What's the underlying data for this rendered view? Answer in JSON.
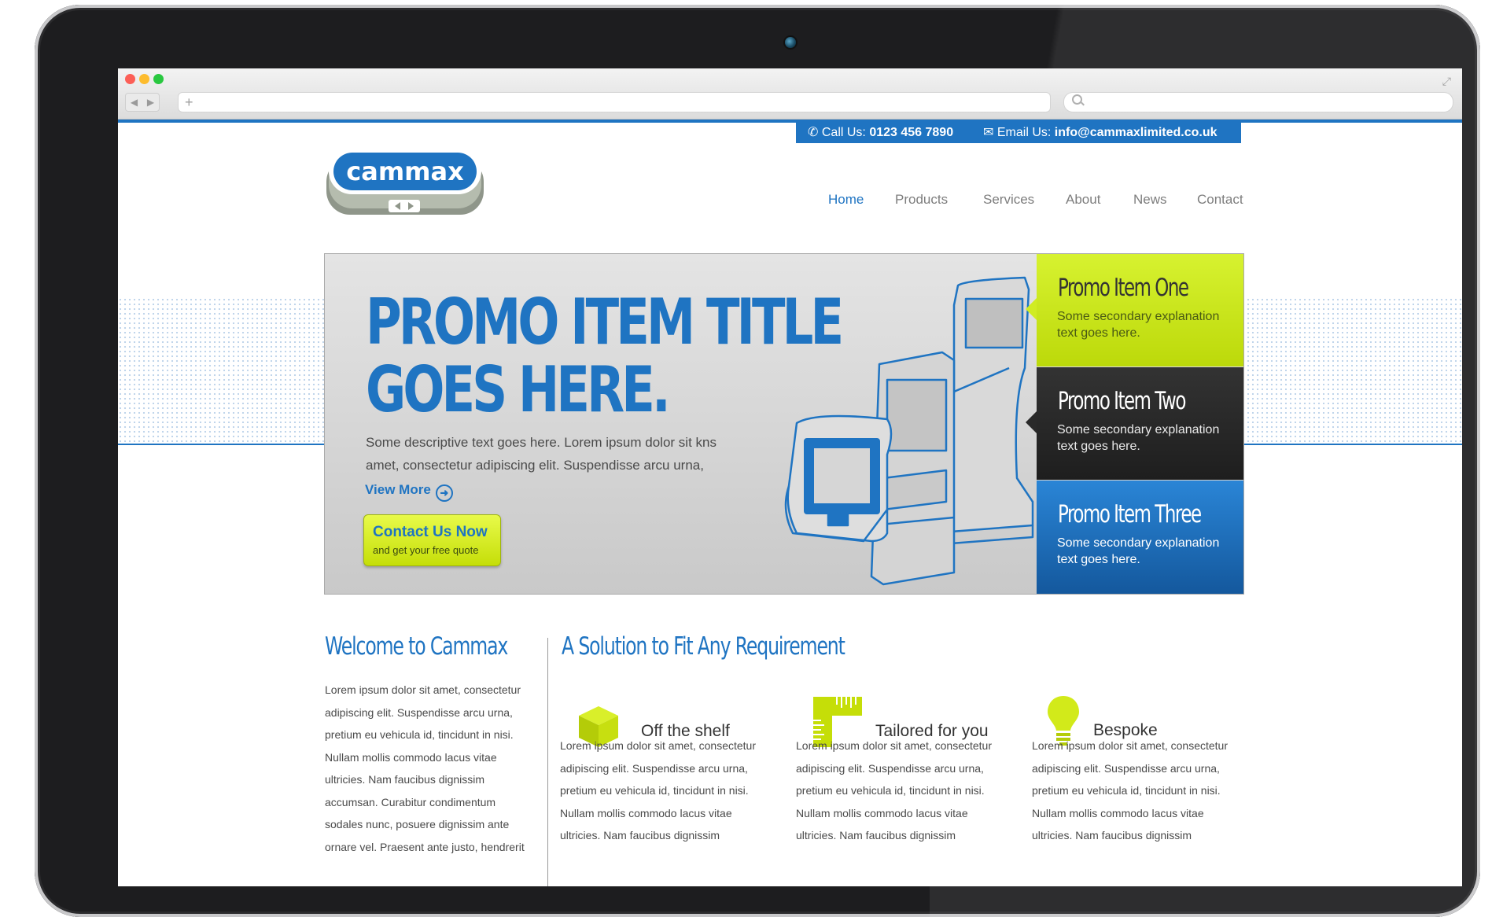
{
  "contact": {
    "call_label": "Call Us:",
    "phone": "0123 456 7890",
    "email_label": "Email Us:",
    "email": "info@cammaxlimited.co.uk"
  },
  "logo": {
    "text": "cammax"
  },
  "nav": {
    "items": [
      {
        "label": "Home",
        "active": true
      },
      {
        "label": "Products",
        "active": false
      },
      {
        "label": "Services",
        "active": false
      },
      {
        "label": "About",
        "active": false
      },
      {
        "label": "News",
        "active": false
      },
      {
        "label": "Contact",
        "active": false
      }
    ]
  },
  "hero": {
    "title_line1": "PROMO ITEM TITLE",
    "title_line2": "GOES HERE.",
    "text_line1": "Some descriptive text goes here. Lorem ipsum dolor sit kns",
    "text_line2": "amet, consectetur adipiscing elit. Suspendisse arcu urna,",
    "view_more": "View More",
    "cta_main": "Contact Us Now",
    "cta_sub": "and get your free quote"
  },
  "promos": [
    {
      "title": "Promo Item One",
      "text_line1": "Some secondary explanation",
      "text_line2": "text goes here."
    },
    {
      "title": "Promo Item Two",
      "text_line1": "Some secondary explanation",
      "text_line2": "text goes here."
    },
    {
      "title": "Promo Item Three",
      "text_line1": "Some secondary explanation",
      "text_line2": "text goes here."
    }
  ],
  "welcome": {
    "heading": "Welcome to Cammax",
    "lines": [
      "Lorem ipsum dolor sit amet, consectetur",
      "adipiscing elit. Suspendisse arcu urna,",
      "pretium eu vehicula id, tincidunt in nisi.",
      "Nullam mollis commodo lacus vitae",
      "ultricies. Nam faucibus dignissim",
      "accumsan. Curabitur condimentum",
      "sodales nunc, posuere dignissim ante",
      "ornare vel. Praesent ante justo, hendrerit"
    ]
  },
  "solution": {
    "heading": "A Solution to Fit Any Requirement",
    "features": [
      {
        "icon": "box-icon",
        "label": "Off the shelf",
        "lines": [
          "Lorem ipsum dolor sit amet, consectetur",
          "adipiscing elit. Suspendisse arcu urna,",
          "pretium eu vehicula id, tincidunt in nisi.",
          "Nullam mollis commodo lacus vitae",
          "ultricies. Nam faucibus dignissim"
        ]
      },
      {
        "icon": "ruler-icon",
        "label": "Tailored for you",
        "lines": [
          "Lorem ipsum dolor sit amet, consectetur",
          "adipiscing elit. Suspendisse arcu urna,",
          "pretium eu vehicula id, tincidunt in nisi.",
          "Nullam mollis commodo lacus vitae",
          "ultricies. Nam faucibus dignissim"
        ]
      },
      {
        "icon": "lightbulb-icon",
        "label": "Bespoke",
        "lines": [
          "Lorem ipsum dolor sit amet, consectetur",
          "adipiscing elit. Suspendisse arcu urna,",
          "pretium eu vehicula id, tincidunt in nisi.",
          "Nullam mollis commodo lacus vitae",
          "ultricies. Nam faucibus dignissim"
        ]
      }
    ]
  },
  "colors": {
    "brand_blue": "#1f74c2",
    "lime": "#c5de08",
    "dark": "#1e1e1e"
  }
}
